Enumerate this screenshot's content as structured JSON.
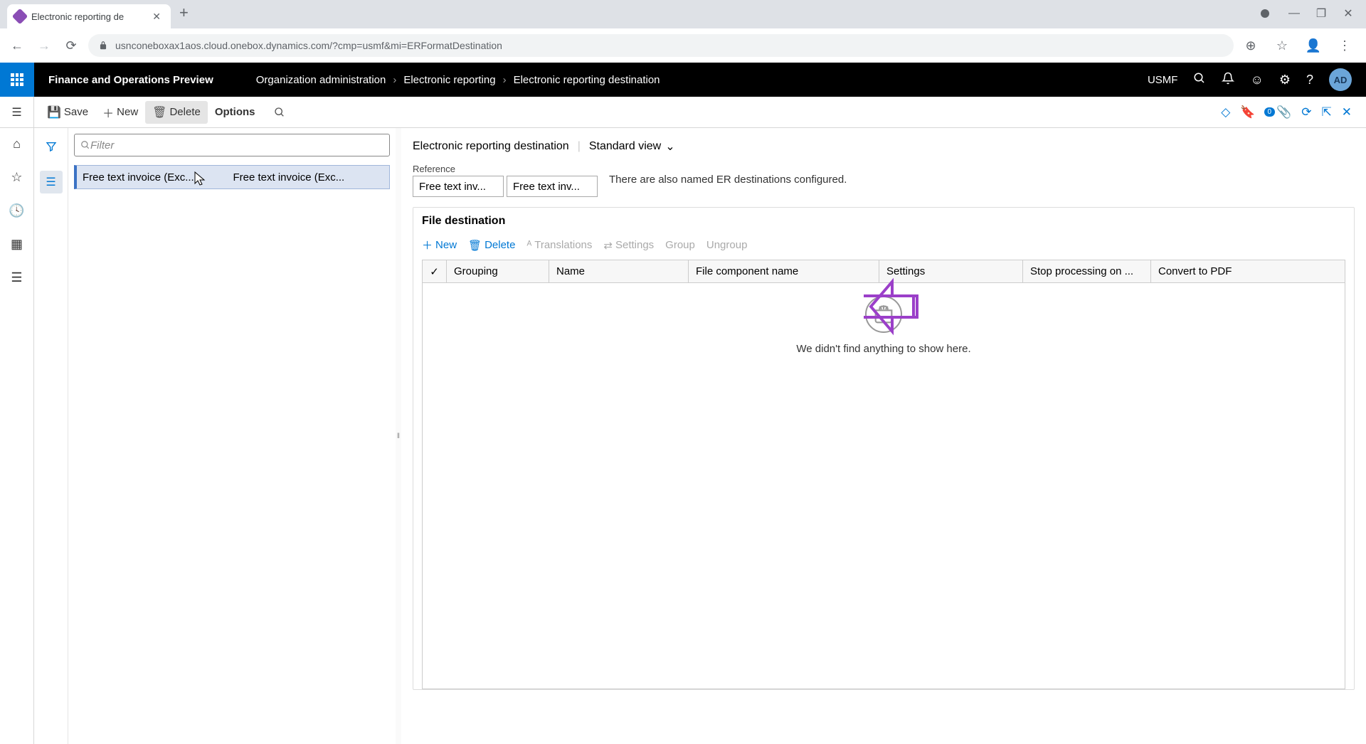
{
  "browser": {
    "tab_title": "Electronic reporting de",
    "url": "usnconeboxax1aos.cloud.onebox.dynamics.com/?cmp=usmf&mi=ERFormatDestination"
  },
  "header": {
    "app_title": "Finance and Operations Preview",
    "breadcrumb": [
      "Organization administration",
      "Electronic reporting",
      "Electronic reporting destination"
    ],
    "company": "USMF",
    "user_initials": "AD"
  },
  "toolbar": {
    "save": "Save",
    "new": "New",
    "delete": "Delete",
    "options": "Options",
    "badge_count": "0"
  },
  "list": {
    "filter_placeholder": "Filter",
    "rows": [
      {
        "col1": "Free text invoice (Exc...",
        "col2": "Free text invoice (Exc..."
      }
    ]
  },
  "detail": {
    "page_title": "Electronic reporting destination",
    "view_label": "Standard view",
    "reference_label": "Reference",
    "reference_values": [
      "Free text inv...",
      "Free text inv..."
    ],
    "reference_note": "There are also named ER destinations configured.",
    "file_dest_title": "File destination",
    "grid_toolbar": {
      "new": "New",
      "delete": "Delete",
      "translations": "Translations",
      "settings": "Settings",
      "group": "Group",
      "ungroup": "Ungroup"
    },
    "grid_headers": {
      "grouping": "Grouping",
      "name": "Name",
      "component": "File component name",
      "settings": "Settings",
      "stop": "Stop processing on ...",
      "convert": "Convert to PDF"
    },
    "empty_message": "We didn't find anything to show here."
  }
}
